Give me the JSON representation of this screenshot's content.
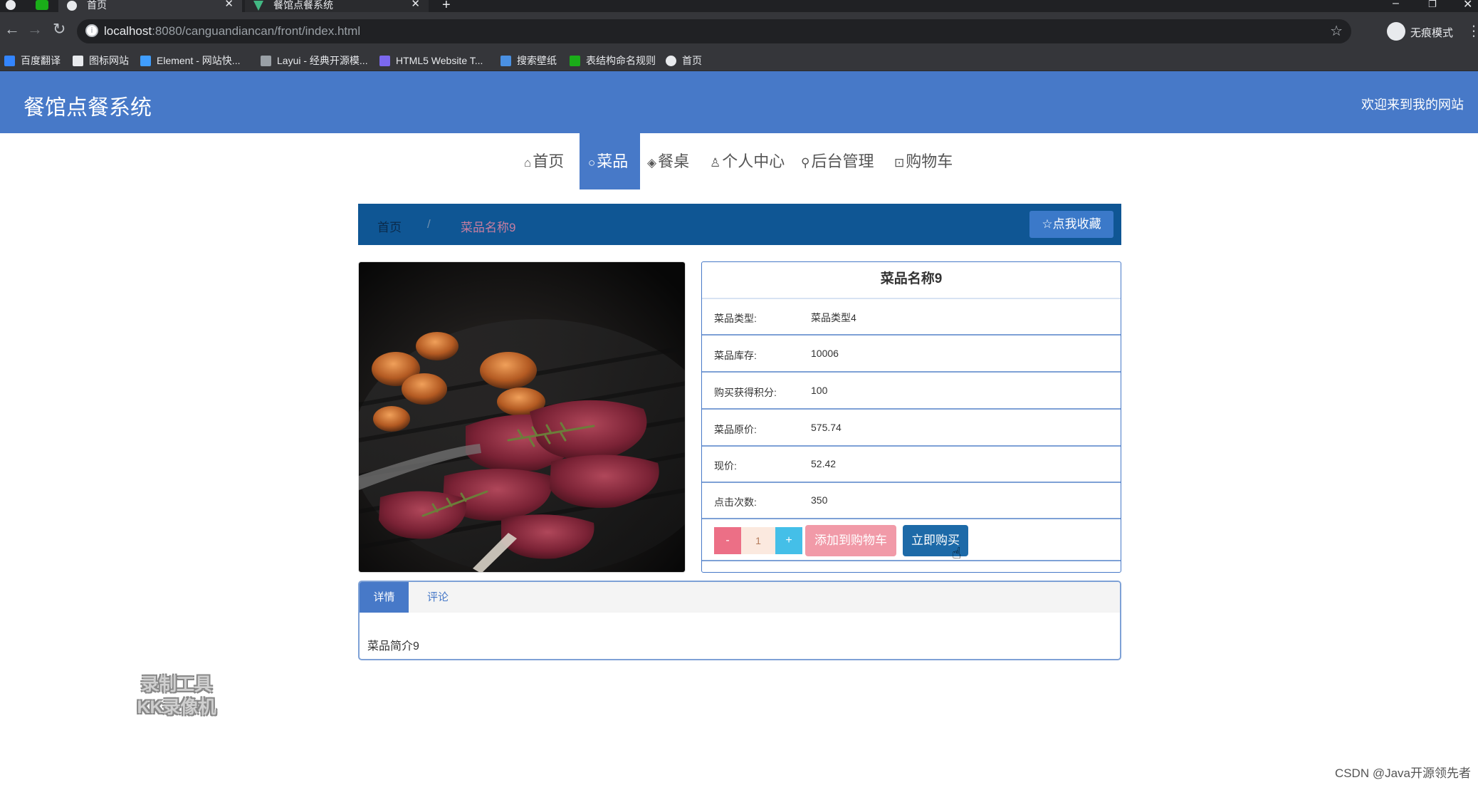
{
  "browser": {
    "tabs": [
      {
        "label": "首页",
        "close": "✕"
      },
      {
        "label": "餐馆点餐系统",
        "close": "✕"
      }
    ],
    "new_tab": "+",
    "window_controls": {
      "minimize": "–",
      "restore": "❐",
      "close": "✕"
    },
    "url_host": "localhost",
    "url_rest": ":8080/canguandiancan/front/index.html",
    "incognito_label": "无痕模式",
    "bookmarks": [
      {
        "label": "百度翻译",
        "icon": "baidu-translate-icon",
        "color": "#3385ff"
      },
      {
        "label": "图标网站",
        "icon": "flag-icon",
        "color": "#e8eaed"
      },
      {
        "label": "Element - 网站快...",
        "icon": "element-icon",
        "color": "#409eff"
      },
      {
        "label": "Layui - 经典开源模...",
        "icon": "layui-icon",
        "color": "#e8eaed"
      },
      {
        "label": "HTML5 Website T...",
        "icon": "html5-icon",
        "color": "#7b68ee"
      },
      {
        "label": "搜索壁纸",
        "icon": "wallpaper-icon",
        "color": "#4a90e2"
      },
      {
        "label": "表结构命名规则",
        "icon": "sheet-icon",
        "color": "#1aad19"
      },
      {
        "label": "首页",
        "icon": "globe-icon",
        "color": "#e8eaed"
      }
    ]
  },
  "header": {
    "title": "餐馆点餐系统",
    "welcome": "欢迎来到我的网站"
  },
  "nav": {
    "items": [
      {
        "icon": "⌂",
        "label": "首页",
        "active": false
      },
      {
        "icon": "○",
        "label": "菜品",
        "active": true
      },
      {
        "icon": "◈",
        "label": "餐桌",
        "active": false
      },
      {
        "icon": "♙",
        "label": "个人中心",
        "active": false
      },
      {
        "icon": "⚲",
        "label": "后台管理",
        "active": false
      },
      {
        "icon": "⊡",
        "label": "购物车",
        "active": false
      }
    ]
  },
  "breadcrumb": {
    "home": "首页",
    "separator": "/",
    "current": "菜品名称9",
    "favorite_icon": "☆",
    "favorite_label": "点我收藏"
  },
  "dish": {
    "name": "菜品名称9",
    "fields": [
      {
        "label": "菜品类型:",
        "value": "菜品类型4"
      },
      {
        "label": "菜品库存:",
        "value": "10006"
      },
      {
        "label": "购买获得积分:",
        "value": "100"
      },
      {
        "label": "菜品原价:",
        "value": "575.74"
      },
      {
        "label": "现价:",
        "value": "52.42"
      },
      {
        "label": "点击次数:",
        "value": "350"
      }
    ],
    "quantity": "1",
    "minus": "-",
    "plus": "+",
    "add_to_cart": "添加到购物车",
    "buy_now": "立即购买"
  },
  "detail_tabs": {
    "tabs": [
      "详情",
      "评论"
    ],
    "active": "详情",
    "content": "菜品简介9"
  },
  "overlays": {
    "recorder_line1": "录制工具",
    "recorder_line2": "KK录像机",
    "csdn": "CSDN @Java开源领先者"
  },
  "colors": {
    "primary": "#4779c8",
    "crumb_bar": "#0f5694",
    "minus": "#ec6f86",
    "plus": "#44bfe8",
    "add_cart": "#f19aa8",
    "buy_now": "#1d6aa8"
  }
}
